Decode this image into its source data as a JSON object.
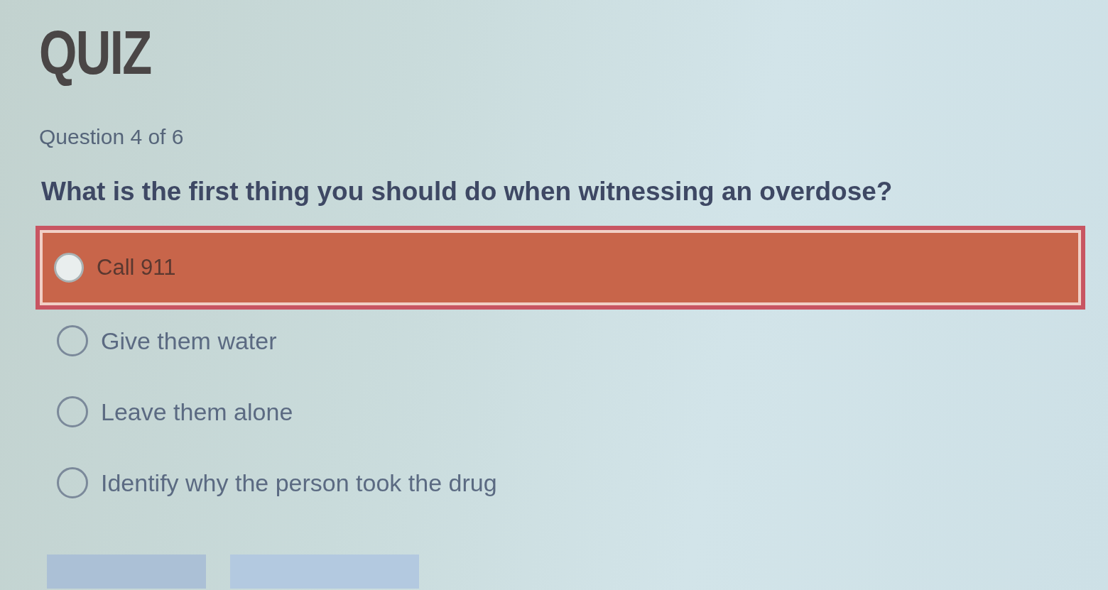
{
  "title": "QUIZ",
  "progress": "Question 4 of 6",
  "question": "What is the first thing you should do when witnessing an overdose?",
  "options": [
    {
      "label": "Call 911",
      "selected": true
    },
    {
      "label": "Give them water",
      "selected": false
    },
    {
      "label": "Leave them alone",
      "selected": false
    },
    {
      "label": "Identify why the person took the drug",
      "selected": false
    }
  ],
  "buttons": [
    {
      "disabled": true
    },
    {
      "disabled": true
    }
  ]
}
